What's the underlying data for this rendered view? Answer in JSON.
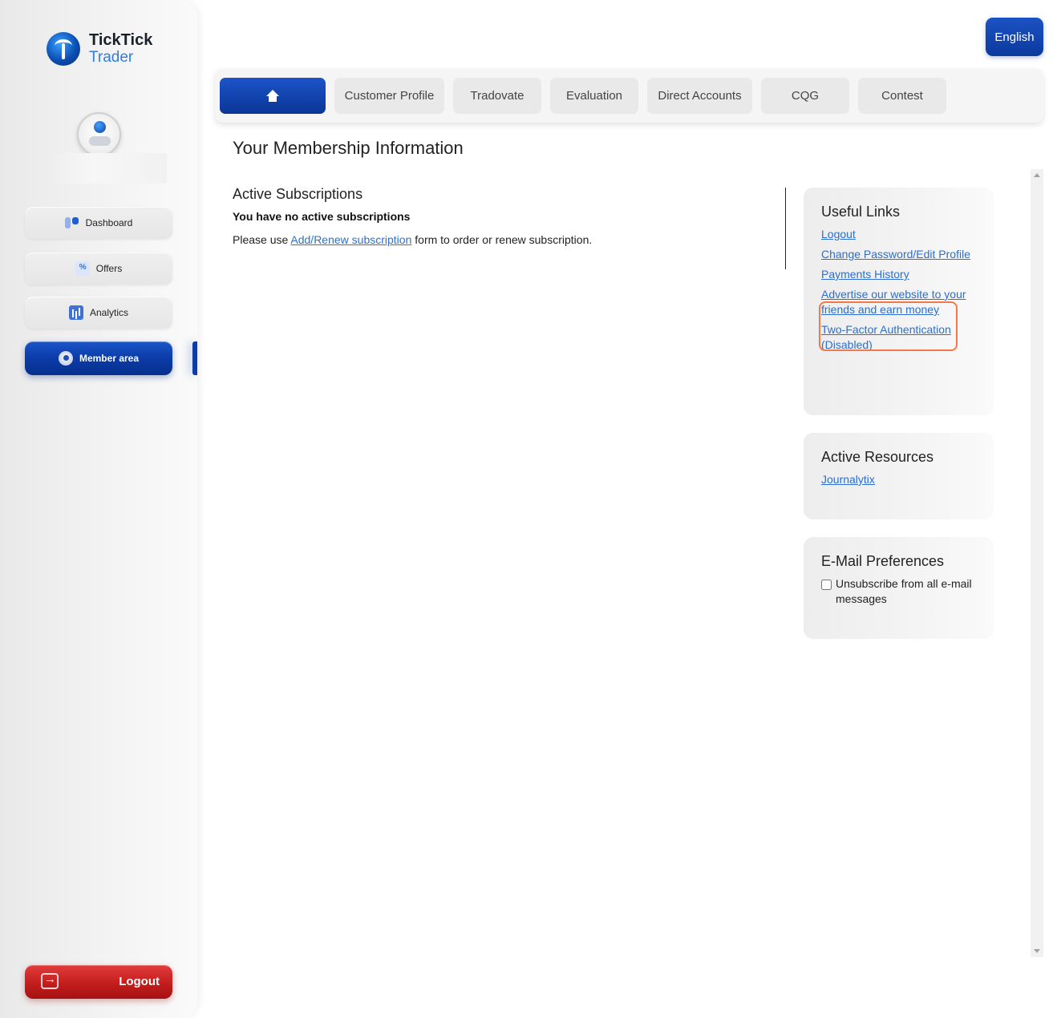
{
  "brand": {
    "line1": "TickTick",
    "line2": "Trader",
    "color_dark": "#1b1f2a",
    "color_accent": "#2f7de1"
  },
  "sidebar": {
    "items": [
      {
        "label": "Dashboard",
        "icon": "dashboard-icon",
        "active": false
      },
      {
        "label": "Offers",
        "icon": "offers-icon",
        "active": false
      },
      {
        "label": "Analytics",
        "icon": "analytics-icon",
        "active": false
      },
      {
        "label": "Member area",
        "icon": "member-icon",
        "active": true
      }
    ],
    "logout_label": "Logout"
  },
  "header": {
    "language": "English"
  },
  "tabs": [
    {
      "label": "",
      "icon": "home-icon",
      "active": true
    },
    {
      "label": "Customer Profile"
    },
    {
      "label": "Tradovate"
    },
    {
      "label": "Evaluation"
    },
    {
      "label": "Direct Accounts"
    },
    {
      "label": "CQG"
    },
    {
      "label": "Contest"
    }
  ],
  "main": {
    "title": "Your Membership Information",
    "subscriptions": {
      "heading": "Active Subscriptions",
      "status": "You have no active subscriptions",
      "text_before": "Please use ",
      "link": "Add/Renew subscription",
      "text_after": " form to order or renew subscription."
    }
  },
  "useful_links": {
    "heading": "Useful Links",
    "links": [
      "Logout",
      "Change Password/Edit Profile",
      "Payments History",
      "Advertise our website to your friends and earn money",
      "Two-Factor Authentication (Disabled)"
    ]
  },
  "active_resources": {
    "heading": "Active Resources",
    "links": [
      "Journalytix"
    ]
  },
  "email_prefs": {
    "heading": "E-Mail Preferences",
    "unsubscribe_label": "Unsubscribe from all e-mail messages",
    "unsubscribe_checked": false
  },
  "colors": {
    "primary": "#0b3ca8",
    "link": "#2a6fd1",
    "danger": "#c31d1d",
    "highlight": "#f07a48"
  }
}
